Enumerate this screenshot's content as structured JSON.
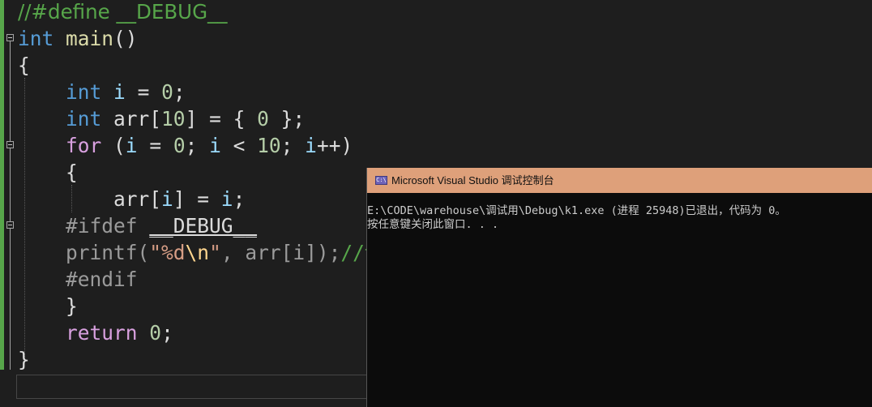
{
  "editor": {
    "lines": [
      {
        "name": "code-line-define-comment",
        "tokens": [
          {
            "cls": "t-comment",
            "text": "//#define __DEBUG__"
          }
        ]
      },
      {
        "name": "code-line-main-signature",
        "tokens": [
          {
            "cls": "t-kw",
            "text": "int"
          },
          {
            "cls": "t-plain",
            "text": " "
          },
          {
            "cls": "t-fn",
            "text": "main"
          },
          {
            "cls": "t-plain",
            "text": "()"
          }
        ]
      },
      {
        "name": "code-line-open-brace",
        "tokens": [
          {
            "cls": "t-plain",
            "text": "{"
          }
        ]
      },
      {
        "name": "code-line-decl-i",
        "tokens": [
          {
            "cls": "t-plain",
            "text": "    "
          },
          {
            "cls": "t-kw",
            "text": "int"
          },
          {
            "cls": "t-plain",
            "text": " "
          },
          {
            "cls": "t-var",
            "text": "i"
          },
          {
            "cls": "t-plain",
            "text": " = "
          },
          {
            "cls": "t-num",
            "text": "0"
          },
          {
            "cls": "t-plain",
            "text": ";"
          }
        ]
      },
      {
        "name": "code-line-decl-arr",
        "tokens": [
          {
            "cls": "t-plain",
            "text": "    "
          },
          {
            "cls": "t-kw",
            "text": "int"
          },
          {
            "cls": "t-plain",
            "text": " arr["
          },
          {
            "cls": "t-num",
            "text": "10"
          },
          {
            "cls": "t-plain",
            "text": "] = { "
          },
          {
            "cls": "t-num",
            "text": "0"
          },
          {
            "cls": "t-plain",
            "text": " };"
          }
        ]
      },
      {
        "name": "code-line-for",
        "tokens": [
          {
            "cls": "t-plain",
            "text": "    "
          },
          {
            "cls": "t-ctrl",
            "text": "for"
          },
          {
            "cls": "t-plain",
            "text": " ("
          },
          {
            "cls": "t-var",
            "text": "i"
          },
          {
            "cls": "t-plain",
            "text": " = "
          },
          {
            "cls": "t-num",
            "text": "0"
          },
          {
            "cls": "t-plain",
            "text": "; "
          },
          {
            "cls": "t-var",
            "text": "i"
          },
          {
            "cls": "t-plain",
            "text": " < "
          },
          {
            "cls": "t-num",
            "text": "10"
          },
          {
            "cls": "t-plain",
            "text": "; "
          },
          {
            "cls": "t-var",
            "text": "i"
          },
          {
            "cls": "t-plain",
            "text": "++)"
          }
        ]
      },
      {
        "name": "code-line-for-open-brace",
        "tokens": [
          {
            "cls": "t-plain",
            "text": "    {"
          }
        ]
      },
      {
        "name": "code-line-assign",
        "tokens": [
          {
            "cls": "t-plain",
            "text": "        arr["
          },
          {
            "cls": "t-var",
            "text": "i"
          },
          {
            "cls": "t-plain",
            "text": "] = "
          },
          {
            "cls": "t-var",
            "text": "i"
          },
          {
            "cls": "t-plain",
            "text": ";"
          }
        ]
      },
      {
        "name": "code-line-ifdef",
        "tokens": [
          {
            "cls": "t-plain",
            "text": "    "
          },
          {
            "cls": "t-pp",
            "text": "#ifdef"
          },
          {
            "cls": "t-plain",
            "text": " "
          },
          {
            "cls": "t-plain ul",
            "text": "__DEBUG__"
          }
        ]
      },
      {
        "name": "code-line-printf",
        "tokens": [
          {
            "cls": "t-plain",
            "text": "    "
          },
          {
            "cls": "t-pp",
            "text": "printf("
          },
          {
            "cls": "t-str",
            "text": "\"%d"
          },
          {
            "cls": "t-esc",
            "text": "\\n"
          },
          {
            "cls": "t-str",
            "text": "\""
          },
          {
            "cls": "t-pp",
            "text": ", arr[i]);"
          },
          {
            "cls": "t-comment",
            "text": "//调"
          }
        ]
      },
      {
        "name": "code-line-endif",
        "tokens": [
          {
            "cls": "t-plain",
            "text": "    "
          },
          {
            "cls": "t-pp",
            "text": "#endif"
          }
        ]
      },
      {
        "name": "code-line-for-close-brace",
        "tokens": [
          {
            "cls": "t-plain",
            "text": "    }"
          }
        ]
      },
      {
        "name": "code-line-return",
        "tokens": [
          {
            "cls": "t-plain",
            "text": "    "
          },
          {
            "cls": "t-ctrl",
            "text": "return"
          },
          {
            "cls": "t-plain",
            "text": " "
          },
          {
            "cls": "t-num",
            "text": "0"
          },
          {
            "cls": "t-plain",
            "text": ";"
          }
        ]
      },
      {
        "name": "code-line-close-brace",
        "tokens": [
          {
            "cls": "t-plain",
            "text": "}"
          }
        ]
      }
    ]
  },
  "console": {
    "title": "Microsoft Visual Studio 调试控制台",
    "icon": "console-app-icon",
    "icon_glyph": "C:\\",
    "output_lines": [
      "E:\\CODE\\warehouse\\调试用\\Debug\\k1.exe (进程 25948)已退出，代码为 0。",
      "按任意键关闭此窗口. . ."
    ]
  },
  "colors": {
    "editor_background": "#1e1e1e",
    "keyword": "#569cd6",
    "control_keyword": "#d8a0df",
    "function": "#dcdcaa",
    "number": "#b5cea8",
    "variable": "#9cdcfe",
    "string": "#d69d85",
    "comment": "#57a64a",
    "inactive_preprocessor": "#9b9b9b",
    "console_titlebar": "#dea07a",
    "console_background": "#0c0c0c"
  }
}
